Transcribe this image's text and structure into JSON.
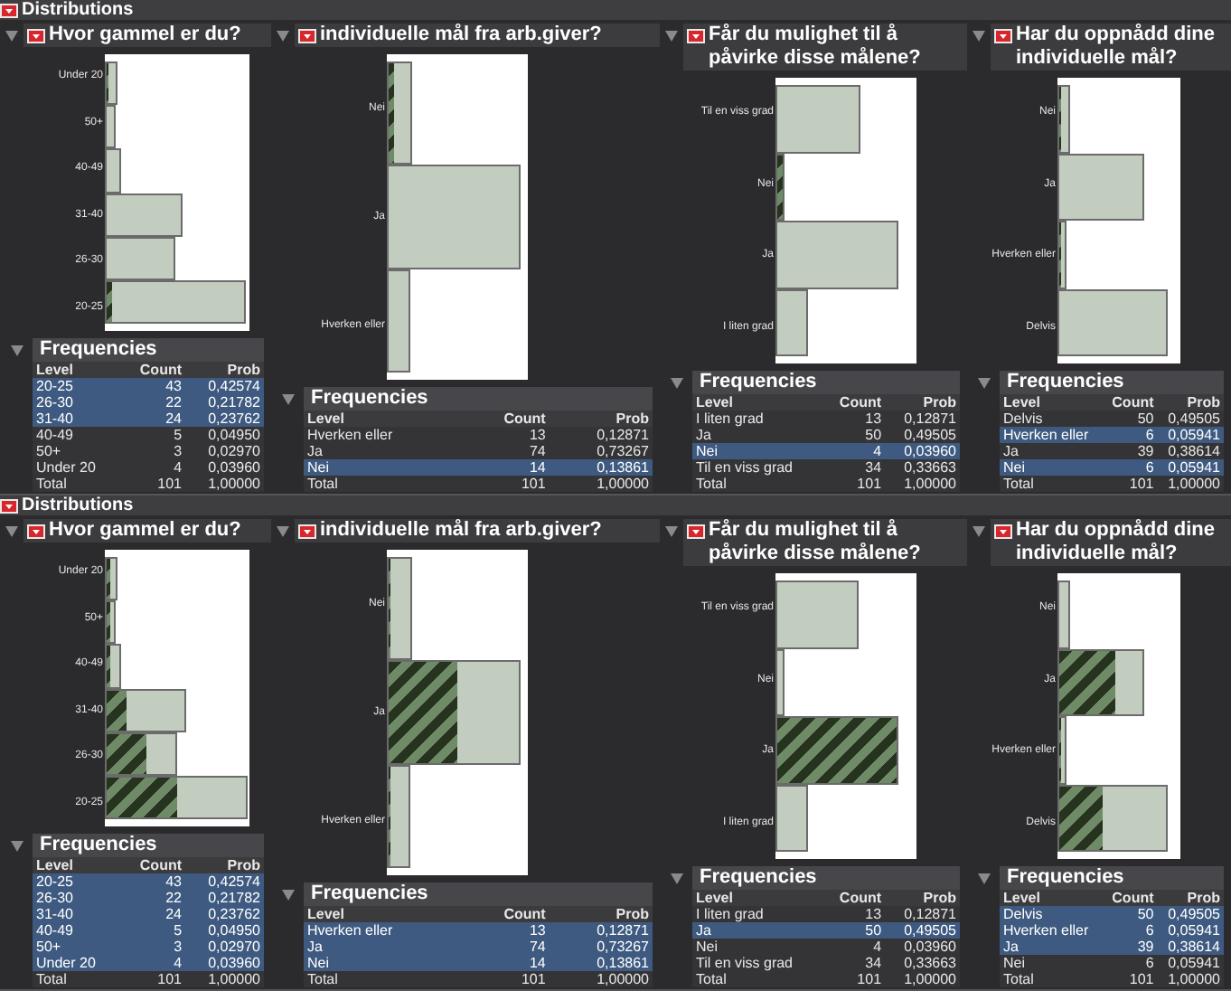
{
  "reports": [
    {
      "title": "Distributions",
      "panels": [
        {
          "title": "Hvor gammel er du?",
          "bars": [
            {
              "label": "Under 20"
            },
            {
              "label": "50+"
            },
            {
              "label": "40-49"
            },
            {
              "label": "31-40"
            },
            {
              "label": "26-30"
            },
            {
              "label": "20-25"
            }
          ],
          "frequencies": {
            "title": "Frequencies",
            "columns": [
              "Level",
              "Count",
              "Prob"
            ],
            "rows": [
              {
                "level": "20-25",
                "count": "43",
                "prob": "0,42574",
                "selected": true
              },
              {
                "level": "26-30",
                "count": "22",
                "prob": "0,21782",
                "selected": true
              },
              {
                "level": "31-40",
                "count": "24",
                "prob": "0,23762",
                "selected": true
              },
              {
                "level": "40-49",
                "count": "5",
                "prob": "0,04950",
                "selected": false
              },
              {
                "level": "50+",
                "count": "3",
                "prob": "0,02970",
                "selected": false
              },
              {
                "level": "Under 20",
                "count": "4",
                "prob": "0,03960",
                "selected": false
              }
            ],
            "total": {
              "label": "Total",
              "count": "101",
              "prob": "1,00000"
            }
          }
        },
        {
          "title": "individuelle mål fra arb.giver?",
          "bars": [
            {
              "label": "Nei"
            },
            {
              "label": "Ja"
            },
            {
              "label": "Hverken eller"
            }
          ],
          "frequencies": {
            "title": "Frequencies",
            "columns": [
              "Level",
              "Count",
              "Prob"
            ],
            "rows": [
              {
                "level": "Hverken eller",
                "count": "13",
                "prob": "0,12871",
                "selected": false
              },
              {
                "level": "Ja",
                "count": "74",
                "prob": "0,73267",
                "selected": false
              },
              {
                "level": "Nei",
                "count": "14",
                "prob": "0,13861",
                "selected": true
              }
            ],
            "total": {
              "label": "Total",
              "count": "101",
              "prob": "1,00000"
            }
          }
        },
        {
          "title": "Får du mulighet til å påvirke disse målene?",
          "bars": [
            {
              "label": "Til en viss grad"
            },
            {
              "label": "Nei"
            },
            {
              "label": "Ja"
            },
            {
              "label": "I liten grad"
            }
          ],
          "frequencies": {
            "title": "Frequencies",
            "columns": [
              "Level",
              "Count",
              "Prob"
            ],
            "rows": [
              {
                "level": "I liten grad",
                "count": "13",
                "prob": "0,12871",
                "selected": false
              },
              {
                "level": "Ja",
                "count": "50",
                "prob": "0,49505",
                "selected": false
              },
              {
                "level": "Nei",
                "count": "4",
                "prob": "0,03960",
                "selected": true
              },
              {
                "level": "Til en viss grad",
                "count": "34",
                "prob": "0,33663",
                "selected": false
              }
            ],
            "total": {
              "label": "Total",
              "count": "101",
              "prob": "1,00000"
            }
          }
        },
        {
          "title": "Har du oppnådd dine individuelle mål?",
          "bars": [
            {
              "label": "Nei"
            },
            {
              "label": "Ja"
            },
            {
              "label": "Hverken eller"
            },
            {
              "label": "Delvis"
            }
          ],
          "frequencies": {
            "title": "Frequencies",
            "columns": [
              "Level",
              "Count",
              "Prob"
            ],
            "rows": [
              {
                "level": "Delvis",
                "count": "50",
                "prob": "0,49505",
                "selected": false
              },
              {
                "level": "Hverken eller",
                "count": "6",
                "prob": "0,05941",
                "selected": true
              },
              {
                "level": "Ja",
                "count": "39",
                "prob": "0,38614",
                "selected": false
              },
              {
                "level": "Nei",
                "count": "6",
                "prob": "0,05941",
                "selected": true
              }
            ],
            "total": {
              "label": "Total",
              "count": "101",
              "prob": "1,00000"
            }
          }
        }
      ]
    },
    {
      "title": "Distributions",
      "panels": [
        {
          "title": "Hvor gammel er du?",
          "bars": [
            {
              "label": "Under 20"
            },
            {
              "label": "50+"
            },
            {
              "label": "40-49"
            },
            {
              "label": "31-40"
            },
            {
              "label": "26-30"
            },
            {
              "label": "20-25"
            }
          ],
          "frequencies": {
            "title": "Frequencies",
            "columns": [
              "Level",
              "Count",
              "Prob"
            ],
            "rows": [
              {
                "level": "20-25",
                "count": "43",
                "prob": "0,42574",
                "selected": true
              },
              {
                "level": "26-30",
                "count": "22",
                "prob": "0,21782",
                "selected": true
              },
              {
                "level": "31-40",
                "count": "24",
                "prob": "0,23762",
                "selected": true
              },
              {
                "level": "40-49",
                "count": "5",
                "prob": "0,04950",
                "selected": true
              },
              {
                "level": "50+",
                "count": "3",
                "prob": "0,02970",
                "selected": true
              },
              {
                "level": "Under 20",
                "count": "4",
                "prob": "0,03960",
                "selected": true
              }
            ],
            "total": {
              "label": "Total",
              "count": "101",
              "prob": "1,00000"
            }
          }
        },
        {
          "title": "individuelle mål fra arb.giver?",
          "bars": [
            {
              "label": "Nei"
            },
            {
              "label": "Ja"
            },
            {
              "label": "Hverken eller"
            }
          ],
          "frequencies": {
            "title": "Frequencies",
            "columns": [
              "Level",
              "Count",
              "Prob"
            ],
            "rows": [
              {
                "level": "Hverken eller",
                "count": "13",
                "prob": "0,12871",
                "selected": true
              },
              {
                "level": "Ja",
                "count": "74",
                "prob": "0,73267",
                "selected": true
              },
              {
                "level": "Nei",
                "count": "14",
                "prob": "0,13861",
                "selected": true
              }
            ],
            "total": {
              "label": "Total",
              "count": "101",
              "prob": "1,00000"
            }
          }
        },
        {
          "title": "Får du mulighet til å påvirke disse målene?",
          "bars": [
            {
              "label": "Til en viss grad"
            },
            {
              "label": "Nei"
            },
            {
              "label": "Ja"
            },
            {
              "label": "I liten grad"
            }
          ],
          "frequencies": {
            "title": "Frequencies",
            "columns": [
              "Level",
              "Count",
              "Prob"
            ],
            "rows": [
              {
                "level": "I liten grad",
                "count": "13",
                "prob": "0,12871",
                "selected": false
              },
              {
                "level": "Ja",
                "count": "50",
                "prob": "0,49505",
                "selected": true
              },
              {
                "level": "Nei",
                "count": "4",
                "prob": "0,03960",
                "selected": false
              },
              {
                "level": "Til en viss grad",
                "count": "34",
                "prob": "0,33663",
                "selected": false
              }
            ],
            "total": {
              "label": "Total",
              "count": "101",
              "prob": "1,00000"
            }
          }
        },
        {
          "title": "Har du oppnådd dine individuelle mål?",
          "bars": [
            {
              "label": "Nei"
            },
            {
              "label": "Ja"
            },
            {
              "label": "Hverken eller"
            },
            {
              "label": "Delvis"
            }
          ],
          "frequencies": {
            "title": "Frequencies",
            "columns": [
              "Level",
              "Count",
              "Prob"
            ],
            "rows": [
              {
                "level": "Delvis",
                "count": "50",
                "prob": "0,49505",
                "selected": true
              },
              {
                "level": "Hverken eller",
                "count": "6",
                "prob": "0,05941",
                "selected": true
              },
              {
                "level": "Ja",
                "count": "39",
                "prob": "0,38614",
                "selected": true
              },
              {
                "level": "Nei",
                "count": "6",
                "prob": "0,05941",
                "selected": false
              }
            ],
            "total": {
              "label": "Total",
              "count": "101",
              "prob": "1,00000"
            }
          }
        }
      ]
    }
  ]
}
